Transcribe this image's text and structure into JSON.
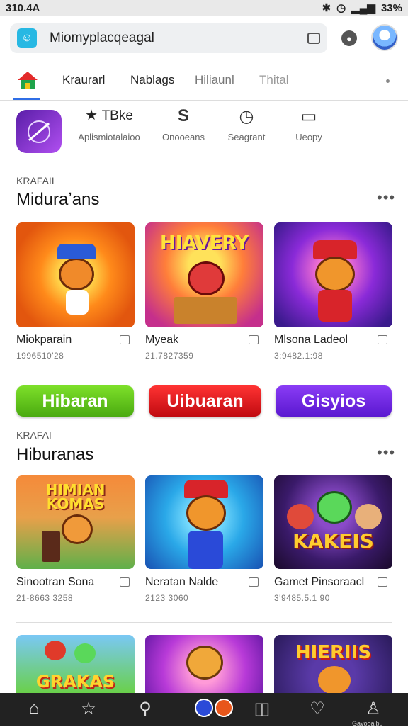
{
  "status_bar": {
    "time": "310.4A",
    "battery": "33%"
  },
  "browser": {
    "url": "Miomyplacqeagal"
  },
  "tabs": [
    {
      "label": "Kraurarl"
    },
    {
      "label": "Nablags"
    },
    {
      "label": "Hiliaunl"
    },
    {
      "label": "Thital"
    }
  ],
  "quick_actions": [
    {
      "title": "TBke",
      "subtitle": "Aplismiotalaioo",
      "icon": "star-icon"
    },
    {
      "label": "Onooeans",
      "icon": "s-logo-icon"
    },
    {
      "label": "Seagrant",
      "icon": "clock-icon"
    },
    {
      "label": "Ueopy",
      "icon": "chat-icon"
    }
  ],
  "section1": {
    "kicker": "KRAFAII",
    "title": "Miduraʼans",
    "more": "•••",
    "cards": [
      {
        "name": "Miokparain",
        "sub": "1996510'28"
      },
      {
        "name": "Myeak",
        "sub": "21.7827359",
        "art_text": "HIAVERY"
      },
      {
        "name": "Mlsona Ladeol",
        "sub": "3:9482.1:98"
      }
    ]
  },
  "pills": [
    {
      "label": "Hibaran",
      "color": "#5fc912"
    },
    {
      "label": "Uibuaran",
      "color": "#e0121a"
    },
    {
      "label": "Gisyios",
      "color": "#6a23e0"
    }
  ],
  "section2": {
    "kicker": "KRAFAI",
    "title": "Hiburanas",
    "more": "•••",
    "cards": [
      {
        "name": "Sinootran Sona",
        "sub": "21-8663 3258",
        "art_text": "HIMIAN KOMAS"
      },
      {
        "name": "Neratan Nalde",
        "sub": "2123 3060"
      },
      {
        "name": "Gamet Pinsoraacl",
        "sub": "3'9485.5.1 90",
        "art_text": "KAKEIS"
      }
    ]
  },
  "section3": {
    "cards": [
      {
        "art_text": "GRAKAS"
      },
      {
        "art_text": ""
      },
      {
        "art_text": "HIERIIS"
      }
    ]
  },
  "bottom_nav": {
    "label": "Gavooalbu"
  }
}
